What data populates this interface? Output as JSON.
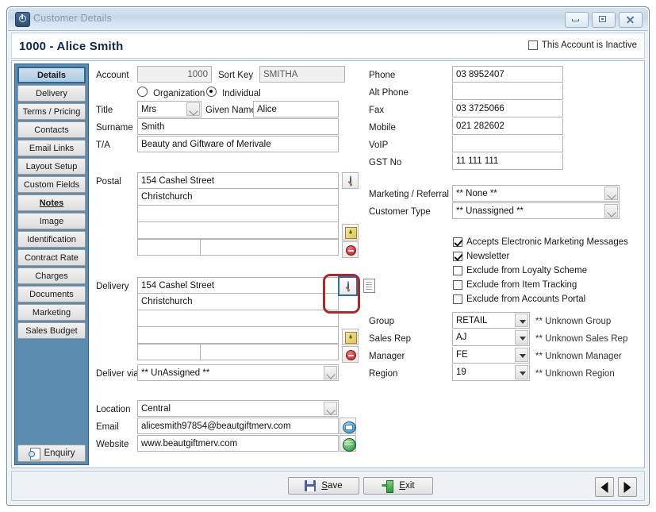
{
  "window": {
    "title": "Customer Details",
    "icon": "power-icon",
    "buttons": {
      "minimize": "minimize-icon",
      "restore": "restore-icon",
      "close": "close-icon"
    }
  },
  "header": {
    "customer_title": "1000 - Alice Smith",
    "inactive_label": "This Account is Inactive",
    "inactive_checked": false
  },
  "sidebar": {
    "items": [
      {
        "label": "Details",
        "selected": true,
        "bold": false
      },
      {
        "label": "Delivery",
        "selected": false,
        "bold": false
      },
      {
        "label": "Terms / Pricing",
        "selected": false,
        "bold": false
      },
      {
        "label": "Contacts",
        "selected": false,
        "bold": false
      },
      {
        "label": "Email Links",
        "selected": false,
        "bold": false
      },
      {
        "label": "Layout Setup",
        "selected": false,
        "bold": false
      },
      {
        "label": "Custom Fields",
        "selected": false,
        "bold": false
      },
      {
        "label": "Notes",
        "selected": false,
        "bold": true
      },
      {
        "label": "Image",
        "selected": false,
        "bold": false
      },
      {
        "label": "Identification",
        "selected": false,
        "bold": false
      },
      {
        "label": "Contract Rate",
        "selected": false,
        "bold": false
      },
      {
        "label": "Charges",
        "selected": false,
        "bold": false
      },
      {
        "label": "Documents",
        "selected": false,
        "bold": false
      },
      {
        "label": "Marketing",
        "selected": false,
        "bold": false
      },
      {
        "label": "Sales Budget",
        "selected": false,
        "bold": false
      }
    ],
    "enquiry_label": "Enquiry"
  },
  "form": {
    "account_label": "Account",
    "account_value": "1000",
    "sort_key_label": "Sort Key",
    "sort_key_value": "SMITHA",
    "entity_type": {
      "organization_label": "Organization",
      "individual_label": "Individual",
      "selected": "Individual"
    },
    "title_label": "Title",
    "title_value": "Mrs",
    "given_name_label": "Given Name",
    "given_name_value": "Alice",
    "surname_label": "Surname",
    "surname_value": "Smith",
    "ta_label": "T/A",
    "ta_value": "Beauty and Giftware of Merivale",
    "postal_label": "Postal",
    "postal_lines": [
      "154 Cashel Street",
      "Christchurch",
      "",
      "",
      ""
    ],
    "postal_postcode": "",
    "delivery_label": "Delivery",
    "delivery_lines": [
      "154 Cashel Street",
      "Christchurch",
      "",
      "",
      ""
    ],
    "delivery_postcode": "",
    "deliver_via_label": "Deliver via",
    "deliver_via_value": "** UnAssigned **",
    "location_label": "Location",
    "location_value": "Central",
    "email_label": "Email",
    "email_value": "alicesmith97854@beautgiftmerv.com",
    "website_label": "Website",
    "website_value": "www.beautgiftmerv.com"
  },
  "contact": {
    "rows": [
      {
        "label": "Phone",
        "value": "03 8952407"
      },
      {
        "label": "Alt Phone",
        "value": ""
      },
      {
        "label": "Fax",
        "value": "03 3725066"
      },
      {
        "label": "Mobile",
        "value": "021 282602"
      },
      {
        "label": "VoIP",
        "value": ""
      },
      {
        "label": "GST No",
        "value": "11 111 111"
      }
    ]
  },
  "classification": {
    "marketing_label": "Marketing / Referral",
    "marketing_value": "** None **",
    "customer_type_label": "Customer Type",
    "customer_type_value": "** Unassigned **"
  },
  "checkboxes": [
    {
      "label": "Accepts Electronic Marketing Messages",
      "checked": true
    },
    {
      "label": "Newsletter",
      "checked": true
    },
    {
      "label": "Exclude from Loyalty Scheme",
      "checked": false
    },
    {
      "label": "Exclude from Item Tracking",
      "checked": false
    },
    {
      "label": "Exclude from Accounts Portal",
      "checked": false
    }
  ],
  "assignments": [
    {
      "label": "Group",
      "value": "RETAIL",
      "note": "** Unknown Group"
    },
    {
      "label": "Sales Rep",
      "value": "AJ",
      "note": "** Unknown Sales Rep"
    },
    {
      "label": "Manager",
      "value": "FE",
      "note": "** Unknown Manager"
    },
    {
      "label": "Region",
      "value": "19",
      "note": "** Unknown Region"
    }
  ],
  "footer": {
    "save_label": "Save",
    "save_accel": "S",
    "exit_label": "Exit",
    "exit_accel": "E",
    "prev_label": "prev-record",
    "next_label": "next-record"
  },
  "highlight": {
    "target": "delivery-address-search-button",
    "color": "#b0262c"
  }
}
